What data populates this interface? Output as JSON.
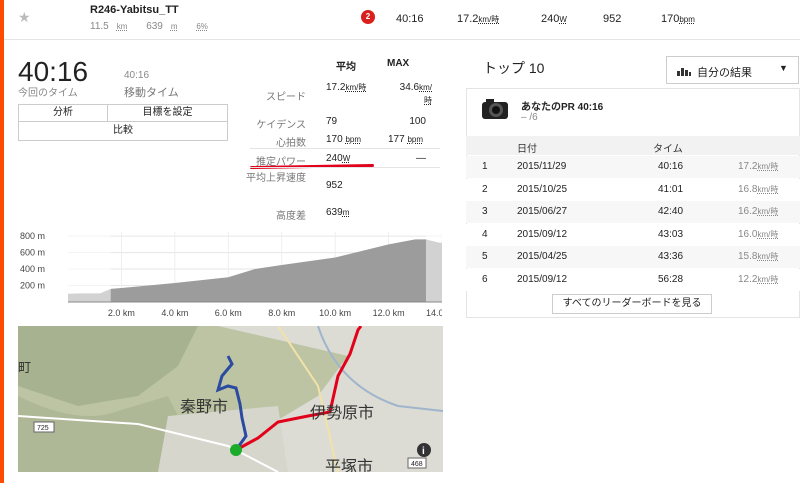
{
  "segment": {
    "name": "R246-Yabitsu_TT",
    "distance_value": "11.5",
    "distance_unit": "km",
    "elev_value": "639",
    "elev_unit": "m",
    "grade": "6%",
    "rank_badge": "2",
    "time": "40:16",
    "speed_value": "17.2",
    "speed_unit": "km/時",
    "power_value": "240",
    "power_unit": "W",
    "climb": "952",
    "hr_value": "170",
    "hr_unit": "bpm"
  },
  "summary": {
    "elapsed_time": "40:16",
    "elapsed_label": "今回のタイム",
    "moving_time": "40:16",
    "moving_label": "移動タイム",
    "btn_analysis": "分析",
    "btn_goal": "目標を設定",
    "btn_compare": "比較"
  },
  "stats": {
    "hdr_avg": "平均",
    "hdr_max": "MAX",
    "rows": [
      {
        "label": "スピード",
        "avg": "17.2",
        "avg_unit": "km/時",
        "max": "34.6",
        "max_unit": "km/時"
      },
      {
        "label": "ケイデンス",
        "avg": "79",
        "avg_unit": "",
        "max": "100",
        "max_unit": ""
      },
      {
        "label": "心拍数",
        "avg": "170",
        "avg_unit": "bpm",
        "max": "177",
        "max_unit": "bpm"
      },
      {
        "label": "推定パワー",
        "avg": "240",
        "avg_unit": "W",
        "max": "—",
        "max_unit": ""
      },
      {
        "label": "平均上昇速度",
        "avg": "952",
        "avg_unit": "",
        "max": "",
        "max_unit": ""
      },
      {
        "label": "高度差",
        "avg": "639",
        "avg_unit": "m",
        "max": "",
        "max_unit": ""
      }
    ]
  },
  "chart_data": {
    "type": "area",
    "title": "",
    "xlabel": "",
    "ylabel": "",
    "x_ticks": [
      "2.0 km",
      "4.0 km",
      "6.0 km",
      "8.0 km",
      "10.0 km",
      "12.0 km",
      "14.0 km"
    ],
    "y_ticks": [
      "800 m",
      "600 m",
      "400 m",
      "200 m"
    ],
    "xlim": [
      0,
      14.0
    ],
    "ylim": [
      0,
      850
    ],
    "x": [
      0,
      0.5,
      1.2,
      1.6,
      2.0,
      4.0,
      6.0,
      7.0,
      8.0,
      10.0,
      12.0,
      13.0,
      13.4,
      13.9,
      14.0
    ],
    "y": [
      100,
      105,
      105,
      160,
      170,
      230,
      300,
      400,
      450,
      540,
      700,
      760,
      760,
      720,
      720
    ],
    "segment_range_km": [
      1.6,
      13.4
    ],
    "grid": true
  },
  "map": {
    "labels": [
      "秦野市",
      "伊勢原市",
      "平塚市",
      "町"
    ],
    "road_shield_725": "725",
    "road_shield_468": "468",
    "info_label": "i"
  },
  "leaderboard": {
    "title": "トップ 10",
    "filter_label": "自分の結果",
    "pr_label": "あなたのPR 40:16",
    "pr_rank": "– /6",
    "col_date": "日付",
    "col_time": "タイム",
    "rows": [
      {
        "rank": "1",
        "date": "2015/11/29",
        "time": "40:16",
        "speed": "17.2",
        "unit": "km/時"
      },
      {
        "rank": "2",
        "date": "2015/10/25",
        "time": "41:01",
        "speed": "16.8",
        "unit": "km/時"
      },
      {
        "rank": "3",
        "date": "2015/06/27",
        "time": "42:40",
        "speed": "16.2",
        "unit": "km/時"
      },
      {
        "rank": "4",
        "date": "2015/09/12",
        "time": "43:03",
        "speed": "16.0",
        "unit": "km/時"
      },
      {
        "rank": "5",
        "date": "2015/04/25",
        "time": "43:36",
        "speed": "15.8",
        "unit": "km/時"
      },
      {
        "rank": "6",
        "date": "2015/09/12",
        "time": "56:28",
        "speed": "12.2",
        "unit": "km/時"
      }
    ],
    "view_all": "すべてのリーダーボードを見る"
  },
  "colors": {
    "accent": "#fc4c02",
    "route": "#e2001a",
    "track": "#2b4aa0",
    "start": "#1aab2b"
  }
}
